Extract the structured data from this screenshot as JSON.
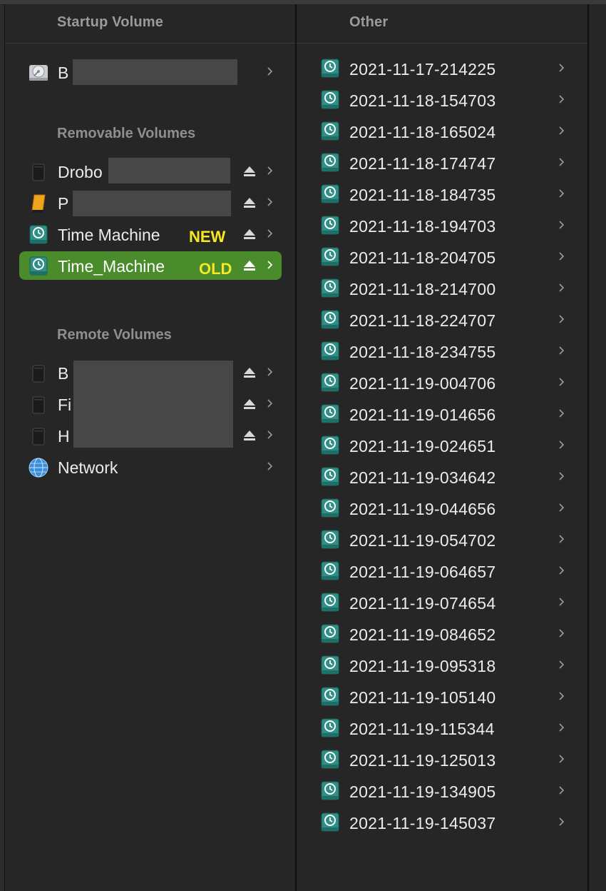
{
  "columns": {
    "left_header": "Startup Volume",
    "right_header": "Other"
  },
  "left": {
    "startup_volume": {
      "label": "B"
    },
    "removable_header": "Removable Volumes",
    "removable": [
      {
        "label": "Drobo",
        "tag": ""
      },
      {
        "label": "P",
        "tag": ""
      },
      {
        "label": "Time Machine",
        "tag": "NEW"
      },
      {
        "label": "Time_Machine",
        "tag": "OLD"
      }
    ],
    "remote_header": "Remote Volumes",
    "remote": [
      {
        "label": "B"
      },
      {
        "label": "Fi"
      },
      {
        "label": "H"
      },
      {
        "label": "Network"
      }
    ]
  },
  "snapshots": [
    "2021-11-17-214225",
    "2021-11-18-154703",
    "2021-11-18-165024",
    "2021-11-18-174747",
    "2021-11-18-184735",
    "2021-11-18-194703",
    "2021-11-18-204705",
    "2021-11-18-214700",
    "2021-11-18-224707",
    "2021-11-18-234755",
    "2021-11-19-004706",
    "2021-11-19-014656",
    "2021-11-19-024651",
    "2021-11-19-034642",
    "2021-11-19-044656",
    "2021-11-19-054702",
    "2021-11-19-064657",
    "2021-11-19-074654",
    "2021-11-19-084652",
    "2021-11-19-095318",
    "2021-11-19-105140",
    "2021-11-19-115344",
    "2021-11-19-125013",
    "2021-11-19-134905",
    "2021-11-19-145037"
  ],
  "colors": {
    "selection": "#4a8b2c",
    "tag": "#f5ea21",
    "tm_icon": "#2f8f87"
  }
}
